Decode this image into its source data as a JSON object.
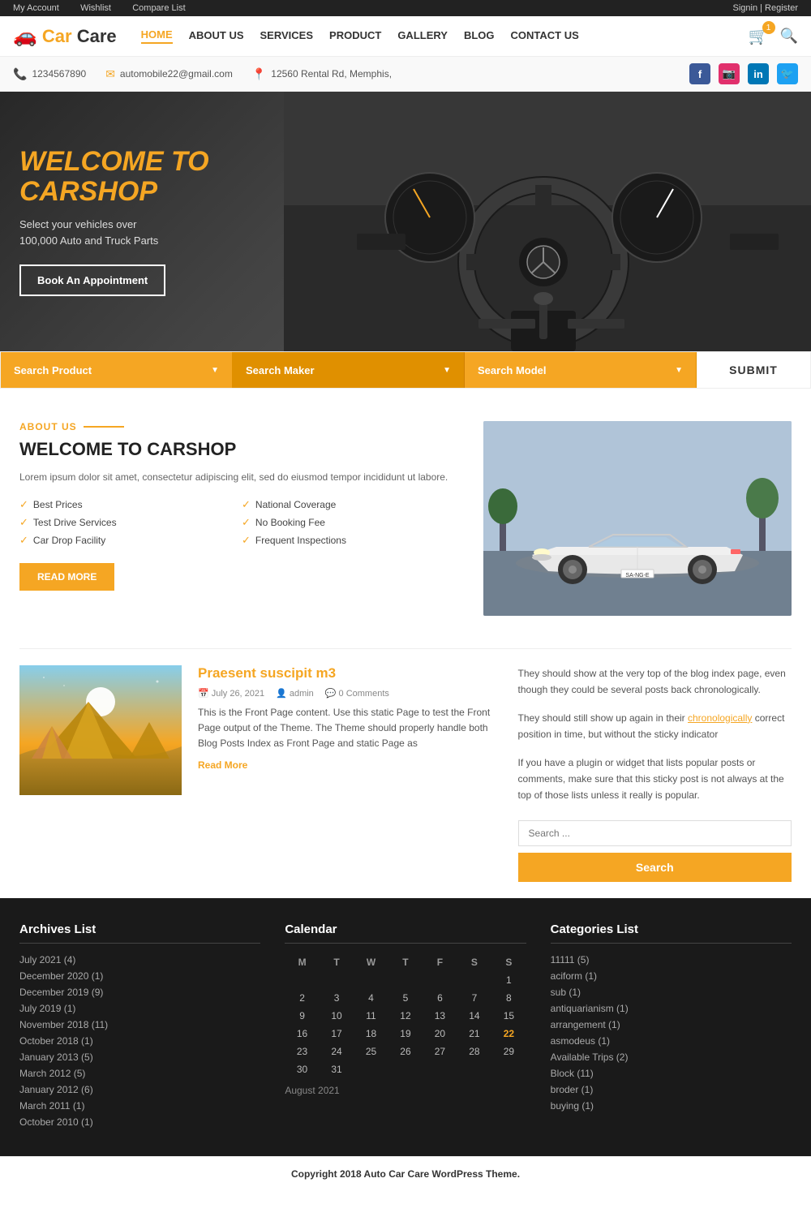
{
  "topbar": {
    "left": [
      "My Account",
      "Wishlist",
      "Compare List"
    ],
    "right": "Signin | Register"
  },
  "header": {
    "logo": "Car Care",
    "logo_icon": "🚗",
    "nav": [
      {
        "label": "HOME",
        "active": true
      },
      {
        "label": "ABOUT US",
        "active": false
      },
      {
        "label": "SERVICES",
        "active": false
      },
      {
        "label": "PRODUCT",
        "active": false
      },
      {
        "label": "GALLERY",
        "active": false
      },
      {
        "label": "BLOG",
        "active": false
      },
      {
        "label": "CONTACT US",
        "active": false
      }
    ],
    "cart_count": "1",
    "cart_icon": "🛒",
    "search_icon": "🔍"
  },
  "info_bar": {
    "phone": "1234567890",
    "email": "automobile22@gmail.com",
    "address": "12560 Rental Rd, Memphis,",
    "phone_icon": "📞",
    "email_icon": "✉",
    "address_icon": "📍"
  },
  "hero": {
    "title_line1": "WELCOME TO",
    "title_line2": "CARSHOP",
    "subtitle": "Select your vehicles over\n100,000 Auto and Truck Parts",
    "cta_label": "Book An Appointment"
  },
  "search_bar": {
    "product_label": "Search Product",
    "maker_label": "Search Maker",
    "model_label": "Search Model",
    "submit_label": "SUBMIT"
  },
  "about": {
    "label": "ABOUT US",
    "title": "WELCOME TO CARSHOP",
    "desc": "Lorem ipsum dolor sit amet, consectetur adipiscing elit, sed do eiusmod tempor incididunt ut labore.",
    "features": [
      "Best Prices",
      "National Coverage",
      "Test Drive Services",
      "No Booking Fee",
      "Car Drop Facility",
      "Frequent Inspections"
    ],
    "read_more_label": "READ MORE"
  },
  "blog": {
    "post": {
      "title": "Praesent suscipit m3",
      "date": "July 26, 2021",
      "author": "admin",
      "comments": "0 Comments",
      "excerpt": "This is the Front Page content. Use this static Page to test the Front Page output of the Theme. The Theme should properly handle both Blog Posts Index as Front Page and static Page as",
      "read_more": "Read More"
    },
    "sidebar": {
      "text1": "They should show at the very top of the blog index page, even though they could be several posts back chronologically.",
      "text2": "They should still show up again in their chronologically correct position in time, but without the sticky indicator",
      "text3": "If you have a plugin or widget that lists popular posts or comments, make sure that this sticky post is not always at the top of those lists unless it really is popular.",
      "link_text": "chronologically",
      "search_placeholder": "Search ...",
      "search_btn": "Search"
    }
  },
  "footer": {
    "archives_title": "Archives List",
    "archives": [
      "July 2021 (4)",
      "December 2020 (1)",
      "December 2019 (9)",
      "July 2019 (1)",
      "November 2018 (11)",
      "October 2018 (1)",
      "January 2013 (5)",
      "March 2012 (5)",
      "January 2012 (6)",
      "March 2011 (1)",
      "October 2010 (1)"
    ],
    "calendar_title": "Calendar",
    "calendar_month": "August 2021",
    "calendar_days": [
      "M",
      "T",
      "W",
      "T",
      "F",
      "S",
      "S"
    ],
    "calendar_rows": [
      [
        "",
        "",
        "",
        "",
        "",
        "",
        "1"
      ],
      [
        "2",
        "3",
        "4",
        "5",
        "6",
        "7",
        "8"
      ],
      [
        "9",
        "10",
        "11",
        "12",
        "13",
        "14",
        "15"
      ],
      [
        "16",
        "17",
        "18",
        "19",
        "20",
        "21",
        "22"
      ],
      [
        "23",
        "24",
        "25",
        "26",
        "27",
        "28",
        "29"
      ],
      [
        "30",
        "31",
        "",
        "",
        "",
        "",
        ""
      ]
    ],
    "categories_title": "Categories List",
    "categories": [
      "11111 (5)",
      "aciform (1)",
      "sub (1)",
      "antiquarianism (1)",
      "arrangement (1)",
      "asmodeus (1)",
      "Available Trips (2)",
      "Block (11)",
      "broder (1)",
      "buying (1)"
    ],
    "copyright": "Copyright 2018 Auto Car Care WordPress Theme."
  }
}
